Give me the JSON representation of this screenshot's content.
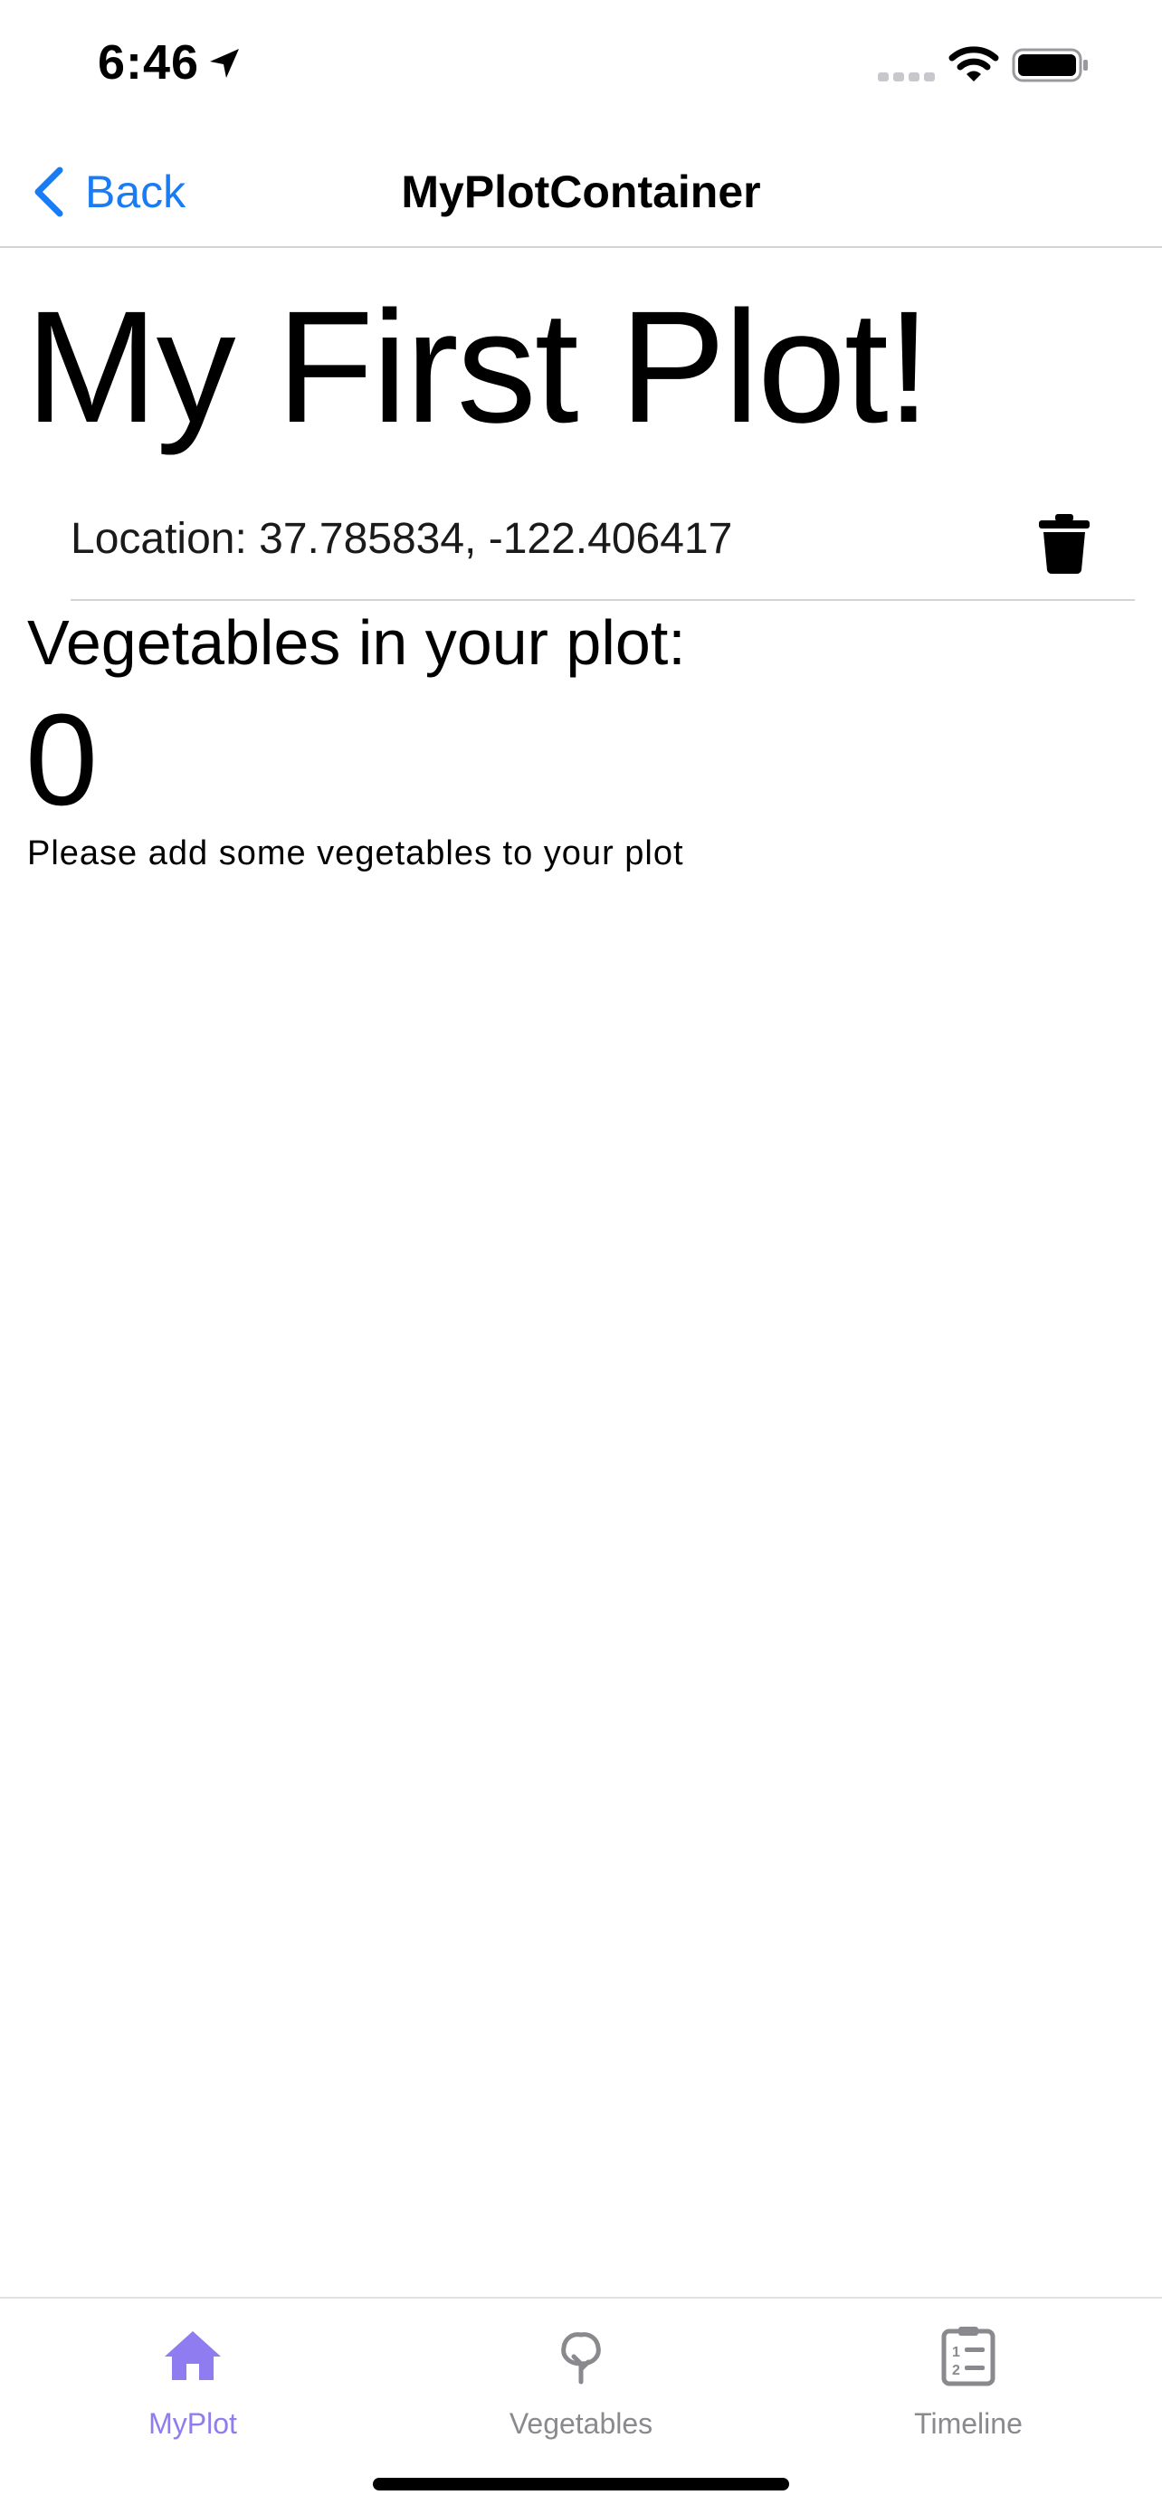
{
  "status_bar": {
    "time": "6:46",
    "icons": [
      "location-arrow-icon",
      "cellular-dots-icon",
      "wifi-icon",
      "battery-icon"
    ]
  },
  "nav": {
    "back_label": "Back",
    "title": "MyPlotContainer"
  },
  "plot": {
    "title": "My First Plot!",
    "location": "Location: 37.785834, -122.406417",
    "vegetables_label": "Vegetables in your plot:",
    "vegetable_count": "0",
    "empty_hint": "Please add some vegetables to your plot"
  },
  "tabs": [
    {
      "label": "MyPlot",
      "icon": "house-icon",
      "selected": true
    },
    {
      "label": "Vegetables",
      "icon": "tree-icon",
      "selected": false
    },
    {
      "label": "Timeline",
      "icon": "clipboard-list-icon",
      "selected": false
    }
  ],
  "colors": {
    "accent": "#1a7cf5",
    "tab_selected": "#8e7cf0",
    "tab_unselected": "#8a8a8e"
  }
}
